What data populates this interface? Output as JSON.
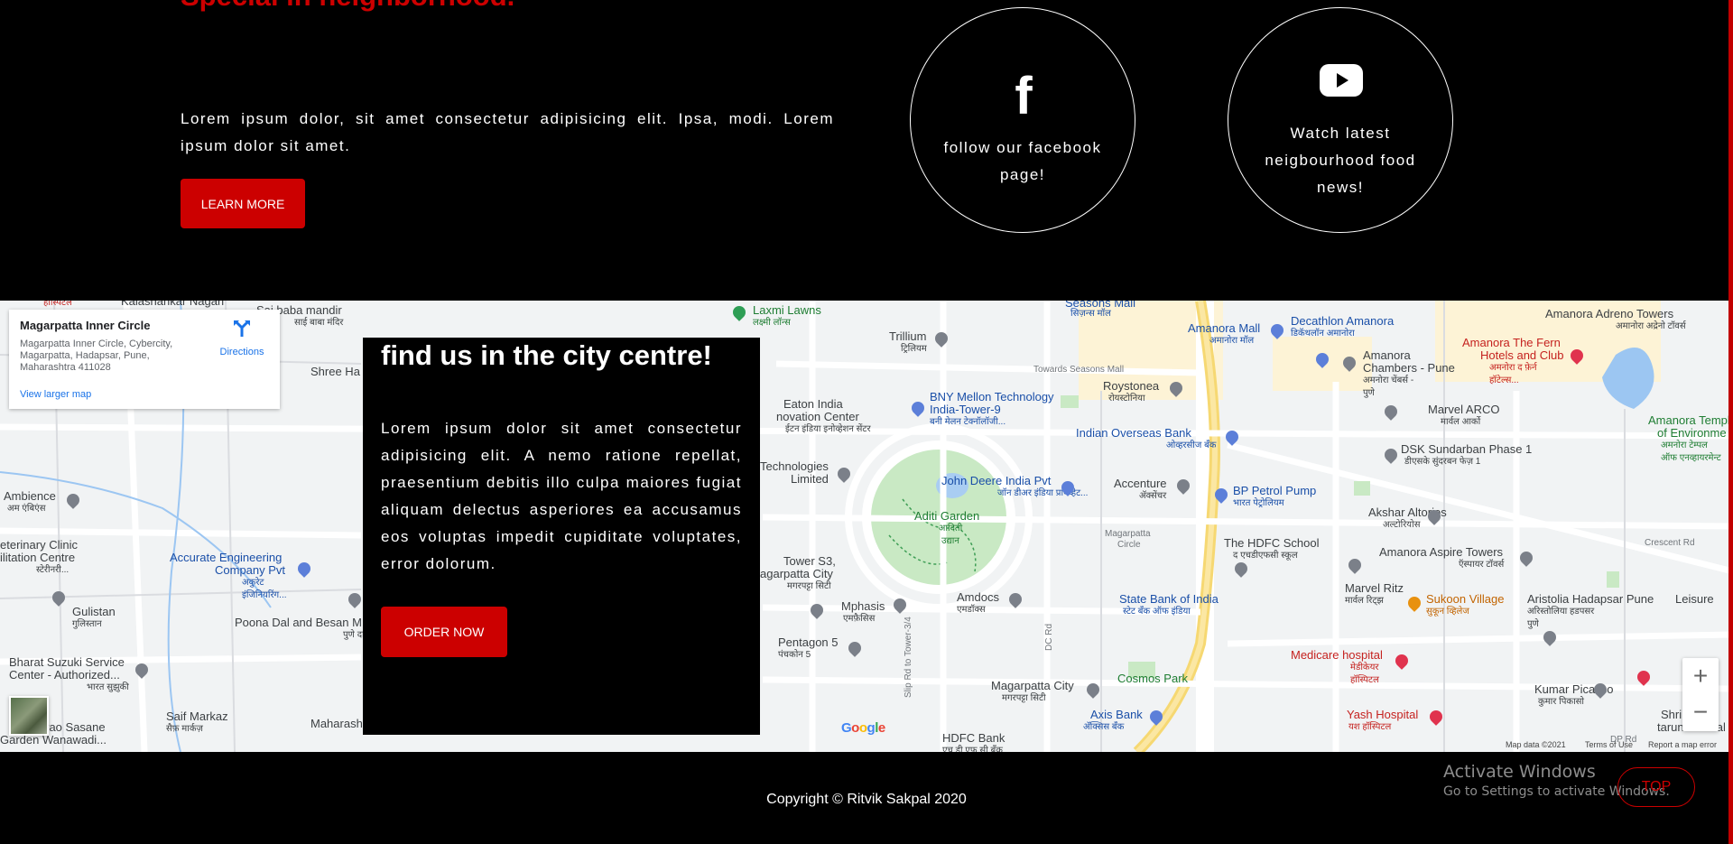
{
  "hero": {
    "heading": "Special in neighborhood.-",
    "text": "Lorem ipsum dolor, sit amet consectetur adipisicing elit. Ipsa, modi. Lorem ipsum dolor sit amet.",
    "button_label": "LEARN MORE"
  },
  "social": {
    "facebook_label": "follow our facebook page!",
    "youtube_label": "Watch latest neigbourhood food news!",
    "facebook_icon": "facebook-icon",
    "youtube_icon": "youtube-icon"
  },
  "map": {
    "place_name": "Magarpatta Inner Circle",
    "place_address": "Magarpatta Inner Circle, Cybercity, Magarpatta, Hadapsar, Pune, Maharashtra 411028",
    "directions_label": "Directions",
    "larger_map_label": "View larger map",
    "zoom_in": "+",
    "zoom_out": "−",
    "google_logo": "Google",
    "map_data": "Map data ©2021",
    "terms": "Terms of Use",
    "report": "Report a map error",
    "labels": {
      "aditi": "Aditi Garden",
      "aditi_sub": "आदिती उद्यान",
      "john_deere": "John Deere India Pvt",
      "john_deere_sub": "जॉन डीअर इंडिया प्रायव्हेट...",
      "bny": "BNY Mellon Technology",
      "bny2": "India-Tower-9",
      "bny_sub": "बनी मेलन टेक्नॉलॉजी...",
      "eaton": "Eaton India",
      "eaton2": "novation Center",
      "eaton_sub": "ईटन इंडिया इनोव्हेशन सेंटर",
      "technologies": "Technologies",
      "limited": "Limited",
      "trillium": "Trillium",
      "trillium_sub": "ट्रिलियम",
      "laxmi": "Laxmi Lawns",
      "laxmi_sub": "लक्ष्मी लॉन्स",
      "seasons": "Seasons Mall",
      "seasons_sub": "सिज़न्स मॉल",
      "towards": "Towards Seasons Mall",
      "amanora_mall": "Amanora Mall",
      "amanora_mall_sub": "अमानोरा मॉल",
      "decathlon": "Decathlon Amanora",
      "decathlon_sub": "डिकॅथलॉन अमानोरा",
      "amanora_chambers": "Amanora",
      "amanora_chambers2": "Chambers - Pune",
      "amanora_chambers_sub": "अमनोरा चेंबर्स - पुणे",
      "adreno": "Amanora Adreno Towers",
      "adreno_sub": "अमानोरा अद्रेनो टॉवर्स",
      "fern": "Amanora The Fern",
      "fern2": "Hotels and Club",
      "fern_sub": "अमनोरा द फ़ेर्न हॉटेल्स...",
      "temple": "Amanora Templ",
      "temple2": "of Environme",
      "temple_sub": "अमनोरा टेम्पल ऑफ एनव्हायरमेन्ट",
      "roystonea": "Roystonea",
      "roystonea_sub": "रोयस्टोनिया",
      "marvel_arco": "Marvel ARCO",
      "marvel_arco_sub": "मार्वल आर्को",
      "overseas": "Indian Overseas Bank",
      "overseas_sub": "ओव्हरसीज बँक",
      "dsk": "DSK Sundarban Phase 1",
      "dsk_sub": "डीएसके सुंदरबन फेज़ 1",
      "accenture": "Accenture",
      "accenture_sub": "ॲक्सेंचर",
      "bp": "BP Petrol Pump",
      "bp_sub": "भारत पेट्रोलियम",
      "akshar": "Akshar Altorios",
      "akshar_sub": "अल्टोरियोस",
      "magarpatta_circle": "Magarpatta",
      "magarpatta_circle2": "Circle",
      "school": "The HDFC School",
      "school_sub": "द एचडीएफसी स्कूल",
      "aspire": "Amanora Aspire Towers",
      "aspire_sub": "ऍस्पायर टॉवर्स",
      "crescent": "Crescent Rd",
      "marvel_ritz": "Marvel Ritz",
      "marvel_ritz_sub": "मार्वल रिट्झ",
      "sbi": "State Bank of India",
      "sbi_sub": "स्टेट बँक ऑफ इंडिया",
      "sukoon": "Sukoon Village",
      "sukoon_sub": "सुकून व्हिलेज",
      "aristolia": "Aristolia Hadapsar Pune",
      "aristolia_sub": "अरिस्तोलिया हडपसर पुणे",
      "leisure": "Leisure",
      "tower_s3": "Tower S3,",
      "tower_s3_2": "agarpatta City",
      "tower_s3_sub": "मगरपट्टा सिटी",
      "mphasis": "Mphasis",
      "mphasis_sub": "एमफ़ैसिस",
      "amdocs": "Amdocs",
      "amdocs_sub": "एमडॉक्स",
      "pentagon": "Pentagon 5",
      "pentagon_sub": "पंचकोन 5",
      "slip_rd": "Slip Rd to Tower-3/4",
      "dc_rd": "DC Rd",
      "cosmos": "Cosmos Park",
      "medicare": "Medicare hospital",
      "medicare_sub": "मेडीकेयर हॉस्पिटल",
      "kumar": "Kumar Picasso",
      "kumar_sub": "कुमार पिकासो",
      "magarpatta_city": "Magarpatta City",
      "magarpatta_city_sub": "मगरपट्टा सिटी",
      "axis": "Axis Bank",
      "axis_sub": "अ‍ॅक्सिस बँक",
      "yash": "Yash Hospital",
      "yash_sub": "यश हॉस्पिटल",
      "shri": "Shri krush",
      "shri2": "tarun mandal",
      "hdfc": "HDFC Bank",
      "hdfc_sub": "एच डी एफ सी बँक",
      "dp_rd": "DP Rd",
      "kalashankar": "Kalashankar Nagari",
      "saibaba": "Sai baba mandir",
      "saibaba_sub": "साई बाबा मंदिर",
      "shree": "Shree Ha",
      "ambience": "Ambience",
      "ambience_sub": "अम एंबिएंस",
      "clinic": "eterinary Clinic",
      "clinic2": "ilitation Centre",
      "clinic_sub": "स्टेरीनरी...",
      "accurate": "Accurate Engineering",
      "accurate2": "Company Pvt",
      "accurate_sub": "अकुरेट इंजिनियरिंग...",
      "gulistan": "Gulistan",
      "gulistan_sub": "गुलिस्तान",
      "poona": "Poona Dal and Besan M",
      "poona_sub": "पुणे दाल और बेसन",
      "bharat": "Bharat Suzuki Service",
      "bharat2": "Center - Authorized...",
      "bharat_sub": "भारत सुझुकी",
      "saif": "Saif Markaz",
      "saif_sub": "सैफ़ मार्कज़",
      "sasane": "ulrao Sasane",
      "sasane2": "Garden Wanawadi...",
      "maharash": "Maharash",
      "hospital_top": "हॉस्पिटल"
    }
  },
  "overlay": {
    "heading": "find us in the city centre!",
    "text": "Lorem ipsum dolor sit amet consectetur adipisicing elit. A nemo ratione repellat, praesentium debitis illo culpa maiores fugiat aliquam delectus asperiores ea accusamus eos voluptas impedit cupiditate voluptates, error dolorum.",
    "button_label": "ORDER NOW"
  },
  "footer": {
    "copyright": "Copyright © Ritvik Sakpal 2020",
    "top_label": "TOP"
  },
  "windows": {
    "activate_title": "Activate Windows",
    "activate_sub": "Go to Settings to activate Windows."
  },
  "colors": {
    "accent": "#cc0000",
    "background": "#000000"
  }
}
